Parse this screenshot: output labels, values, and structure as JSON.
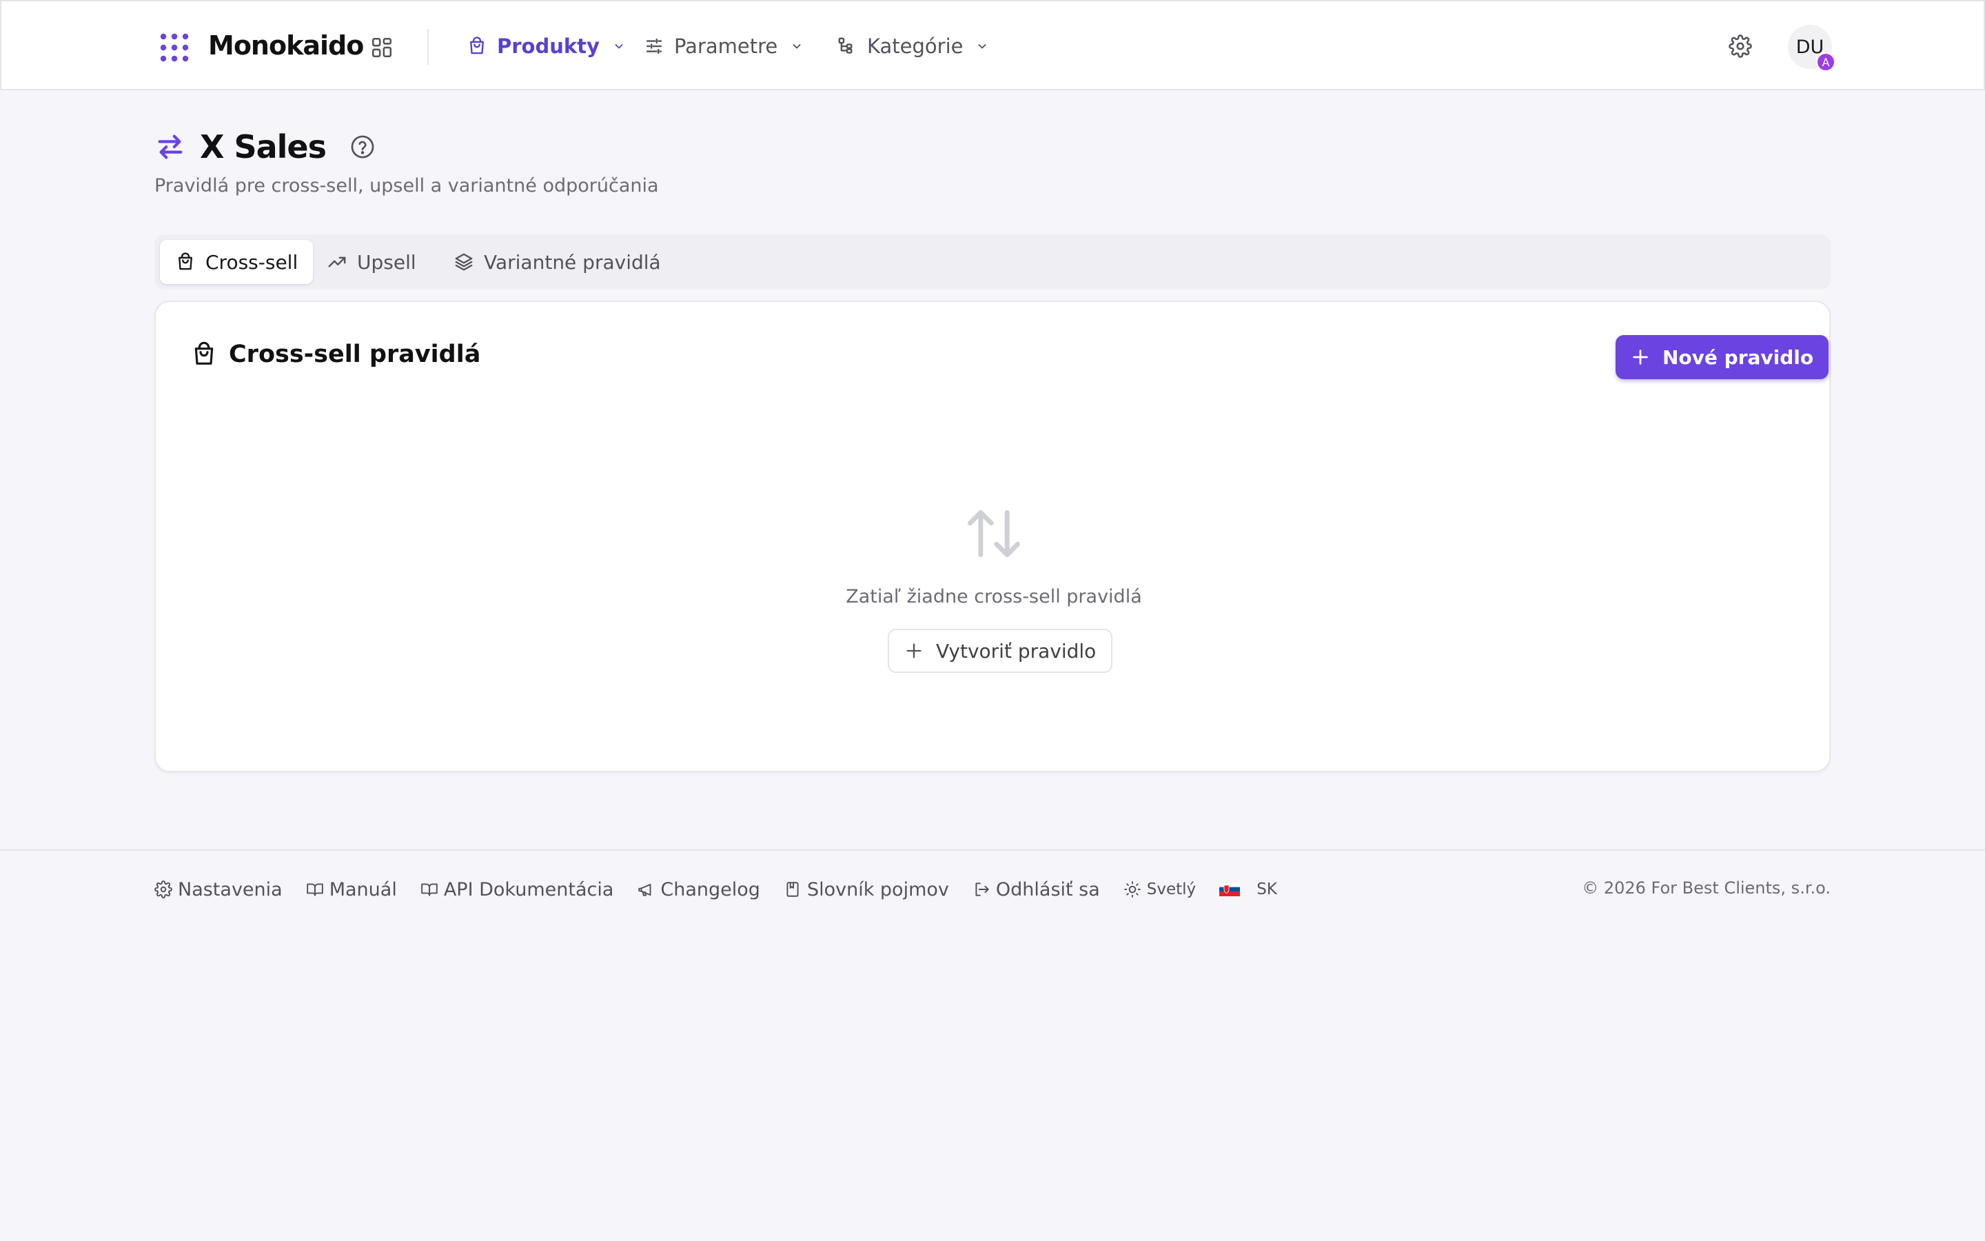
{
  "brand": {
    "name": "Monokaido"
  },
  "nav": {
    "items": [
      {
        "label": "Produkty",
        "icon": "shopping-bag-icon",
        "active": true
      },
      {
        "label": "Parametre",
        "icon": "sliders-icon",
        "active": false
      },
      {
        "label": "Kategórie",
        "icon": "category-tree-icon",
        "active": false
      }
    ]
  },
  "user": {
    "initials": "DU",
    "badge": "A"
  },
  "page": {
    "title": "X Sales",
    "subtitle": "Pravidlá pre cross-sell, upsell a variantné odporúčania"
  },
  "tabs": [
    {
      "label": "Cross-sell",
      "icon": "shopping-bag-icon",
      "active": true
    },
    {
      "label": "Upsell",
      "icon": "trending-up-icon",
      "active": false
    },
    {
      "label": "Variantné pravidlá",
      "icon": "layers-icon",
      "active": false
    }
  ],
  "card": {
    "title": "Cross-sell pravidlá",
    "new_rule_label": "Nové pravidlo",
    "empty_text": "Zatiaľ žiadne cross-sell pravidlá",
    "create_rule_label": "Vytvoriť pravidlo"
  },
  "footer": {
    "links": {
      "settings": "Nastavenia",
      "manual": "Manuál",
      "api_docs": "API Dokumentácia",
      "changelog": "Changelog",
      "glossary": "Slovník pojmov",
      "logout": "Odhlásiť sa",
      "theme": "Svetlý",
      "language": "SK"
    },
    "copyright": "© 2026 For Best Clients, s.r.o."
  },
  "colors": {
    "accent": "#6a43e0",
    "accent_text": "#5b3fd1",
    "background": "#f6f6fa",
    "badge": "#9b3fe0"
  }
}
